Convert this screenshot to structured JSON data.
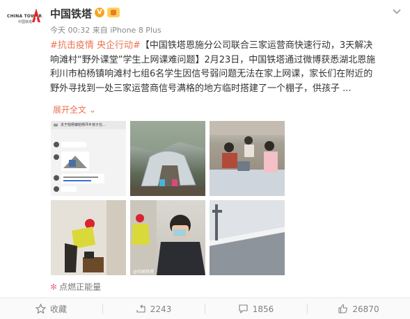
{
  "account": {
    "logo_text_en": "CHINA TOWER",
    "logo_text_cn": "中国铁塔",
    "username": "中国铁塔",
    "verified_icon": "verified-v-icon",
    "level_icon": "member-level-icon"
  },
  "post": {
    "meta": "今天 00:32 来自 iPhone 8 Plus",
    "tags": "#抗击疫情 央企行动#",
    "lines": [
      "【中国铁塔恩施分公司联合三家运营商快速行动，3天解决",
      "响滩村“野外课堂”学生上网课难问题】2月23日，中国铁塔通过微博获悉湖北恩施",
      "利川市柏杨镇响滩村七组6名学生因信号弱问题无法在家上网课，家长们在附近的",
      "野外寻找到一处三家运营商信号满格的地方临时搭建了一个棚子，供孩子 ..."
    ],
    "expand_label": "展开全文",
    "images": [
      {
        "name": "chat-screenshot",
        "thumb_title": "关于柏杨镇柏杨坪乡孩子在…",
        "watermark": ""
      },
      {
        "name": "tent-in-field-photo",
        "watermark": ""
      },
      {
        "name": "students-studying-photo",
        "watermark": ""
      },
      {
        "name": "worker-installing-equipment-photo",
        "watermark": ""
      },
      {
        "name": "worker-on-phone-photo",
        "watermark": "@中国铁塔"
      },
      {
        "name": "antenna-on-building-photo",
        "watermark": ""
      }
    ],
    "positive_energy_label": "点燃正能量"
  },
  "actions": {
    "favorite_label": "收藏",
    "repost_count": "2243",
    "comment_count": "1856",
    "like_count": "26870"
  },
  "colors": {
    "accent": "#eb7350",
    "text": "#333333",
    "meta": "#888888"
  }
}
